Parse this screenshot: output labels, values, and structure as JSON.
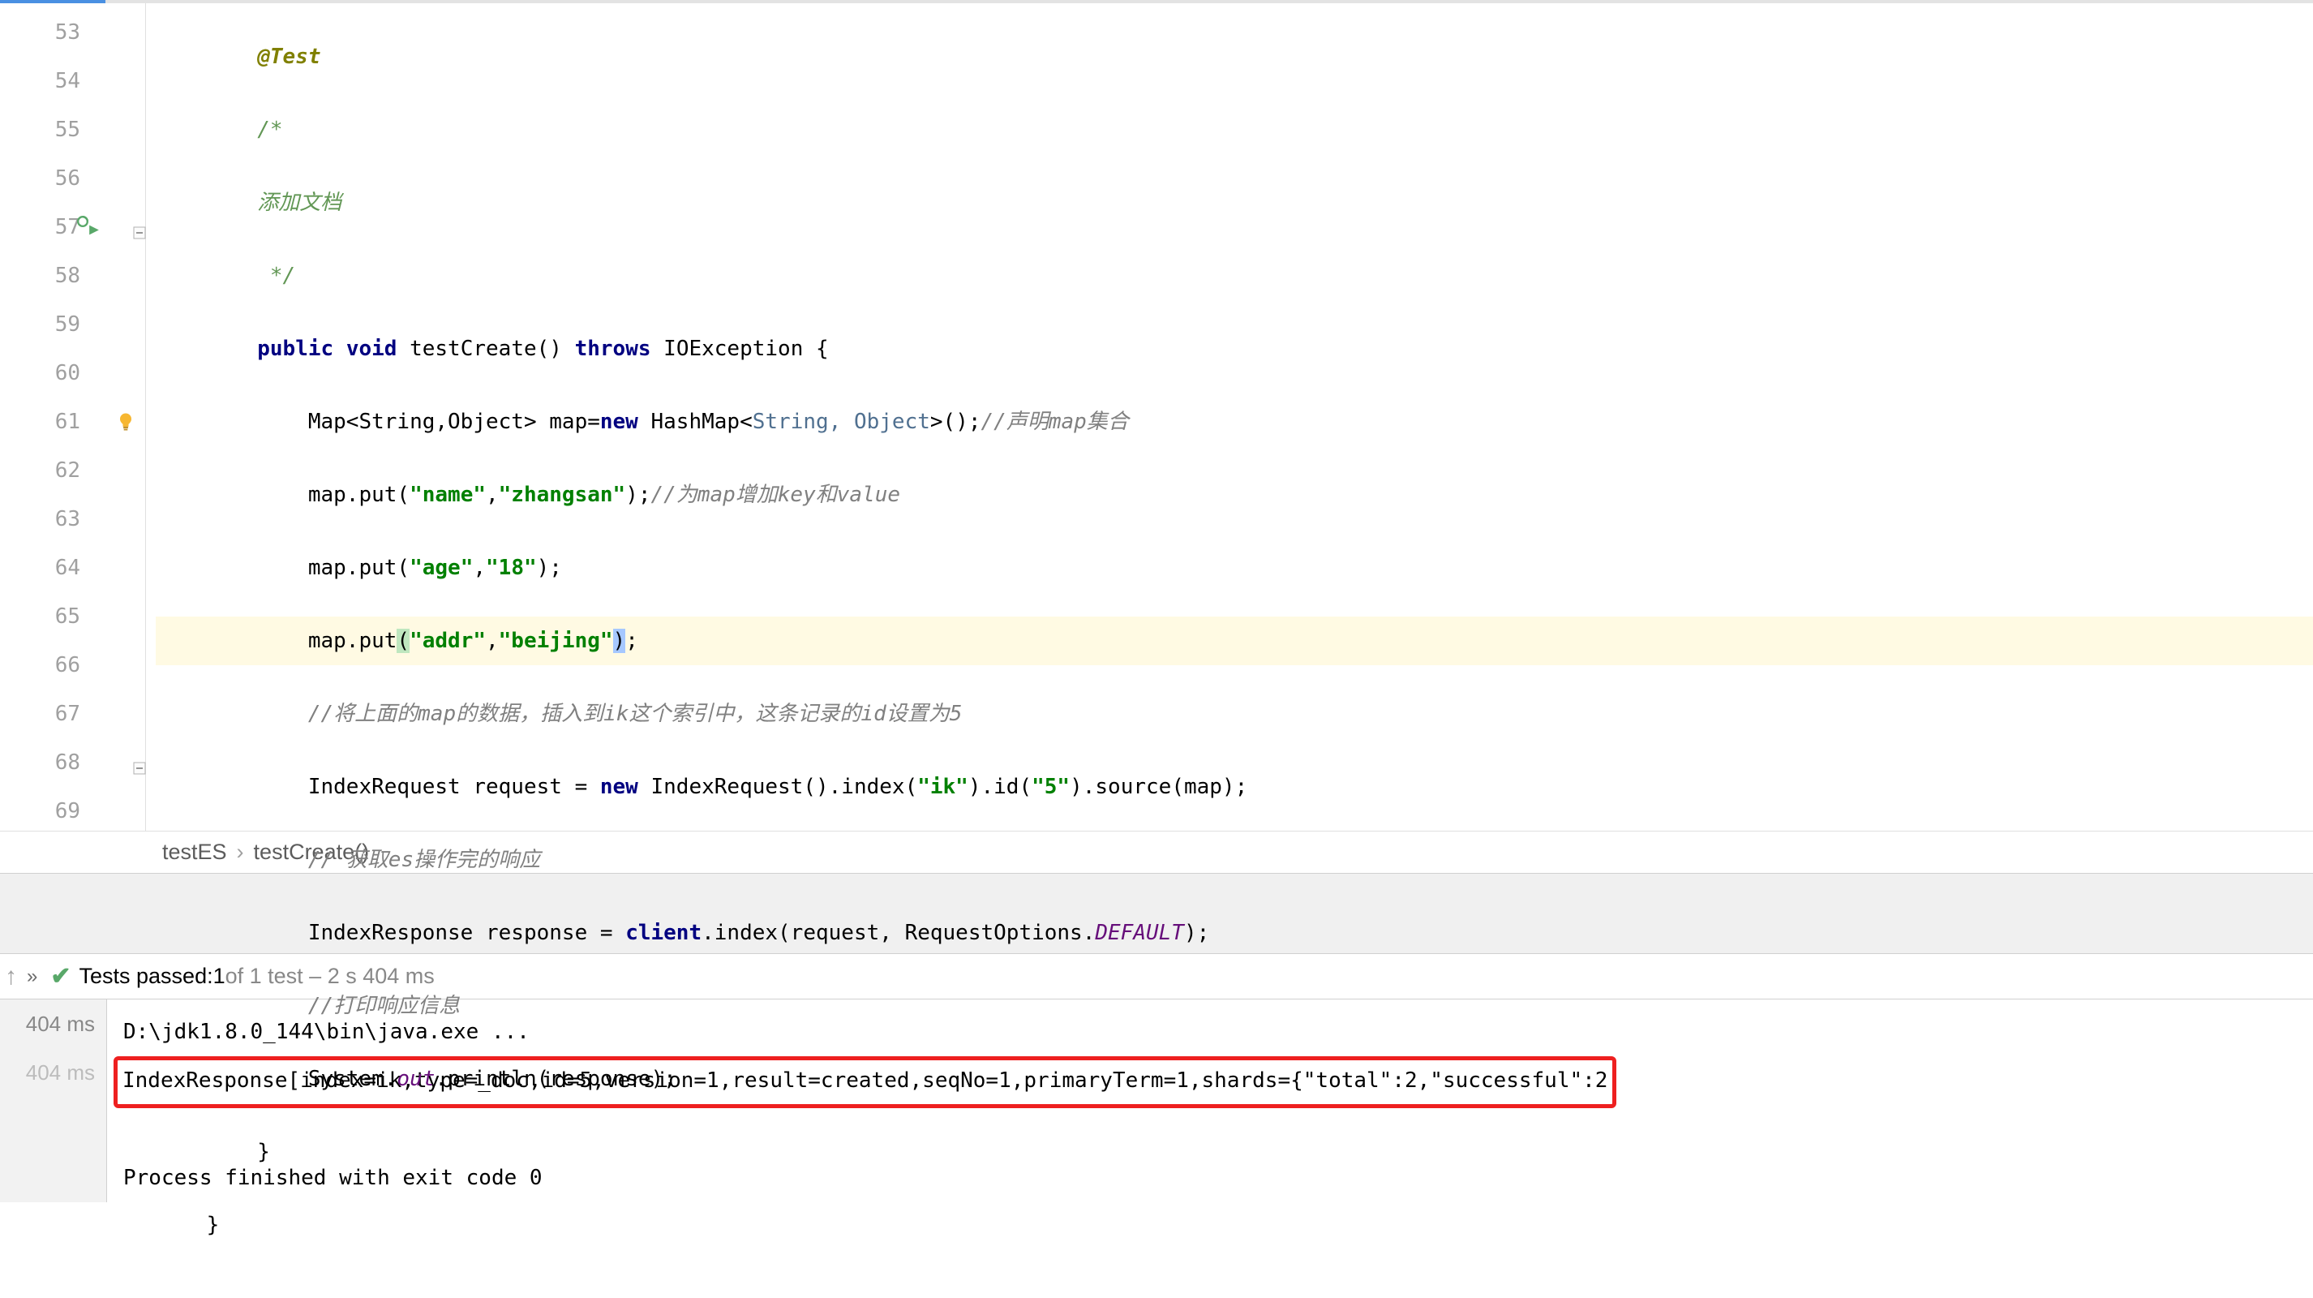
{
  "gutter": {
    "lines": [
      "53",
      "54",
      "55",
      "56",
      "57",
      "58",
      "59",
      "60",
      "61",
      "62",
      "63",
      "64",
      "65",
      "66",
      "67",
      "68",
      "69"
    ]
  },
  "code": {
    "l53_ann": "@Test",
    "l54": "/*",
    "l55": "添加文档",
    "l56": " */",
    "l57_kw1": "public",
    "l57_kw2": "void",
    "l57_name": " testCreate() ",
    "l57_kw3": "throws",
    "l57_ex": " IOException {",
    "l58_a": "Map<String,Object> map=",
    "l58_kw": "new",
    "l58_b": " HashMap<",
    "l58_g": "String, Object",
    "l58_c": ">();",
    "l58_cmt": "//声明map集合",
    "l59_a": "map.put(",
    "l59_s1": "\"name\"",
    "l59_comma": ",",
    "l59_s2": "\"zhangsan\"",
    "l59_b": ");",
    "l59_cmt": "//为map增加key和value",
    "l60_a": "map.put(",
    "l60_s1": "\"age\"",
    "l60_comma": ",",
    "l60_s2": "\"18\"",
    "l60_b": ");",
    "l61_a": "map.put",
    "l61_p1": "(",
    "l61_s1": "\"addr\"",
    "l61_comma": ",",
    "l61_s2": "\"beijing\"",
    "l61_p2": ")",
    "l61_b": ";",
    "l62_cmt": "//将上面的map的数据，插入到ik这个索引中，这条记录的id设置为5",
    "l63_a": "IndexRequest request = ",
    "l63_kw": "new",
    "l63_b": " IndexRequest().index(",
    "l63_s1": "\"ik\"",
    "l63_c": ").id(",
    "l63_s2": "\"5\"",
    "l63_d": ").source(map);",
    "l64_cmt": "// 获取es操作完的响应",
    "l65_a": "IndexResponse response = ",
    "l65_kw": "client",
    "l65_b": ".index(request, RequestOptions.",
    "l65_def": "DEFAULT",
    "l65_c": ");",
    "l66_cmt": "//打印响应信息",
    "l67_a": "System.",
    "l67_out": "out",
    "l67_b": ".println(response);",
    "l68": "}",
    "l69": "}"
  },
  "breadcrumb": {
    "a": "testES",
    "b": "testCreate()"
  },
  "status": {
    "prefix": "Tests passed:",
    "passed": " 1",
    "suffix": " of 1 test – 2 s 404 ms"
  },
  "console": {
    "left0": "404 ms",
    "left1": "404 ms",
    "line0": "D:\\jdk1.8.0_144\\bin\\java.exe ...",
    "line1": "IndexResponse[index=ik,type=_doc,id=5,version=1,result=created,seqNo=1,primaryTerm=1,shards={\"total\":2,\"successful\":2",
    "line3": "Process finished with exit code 0"
  }
}
